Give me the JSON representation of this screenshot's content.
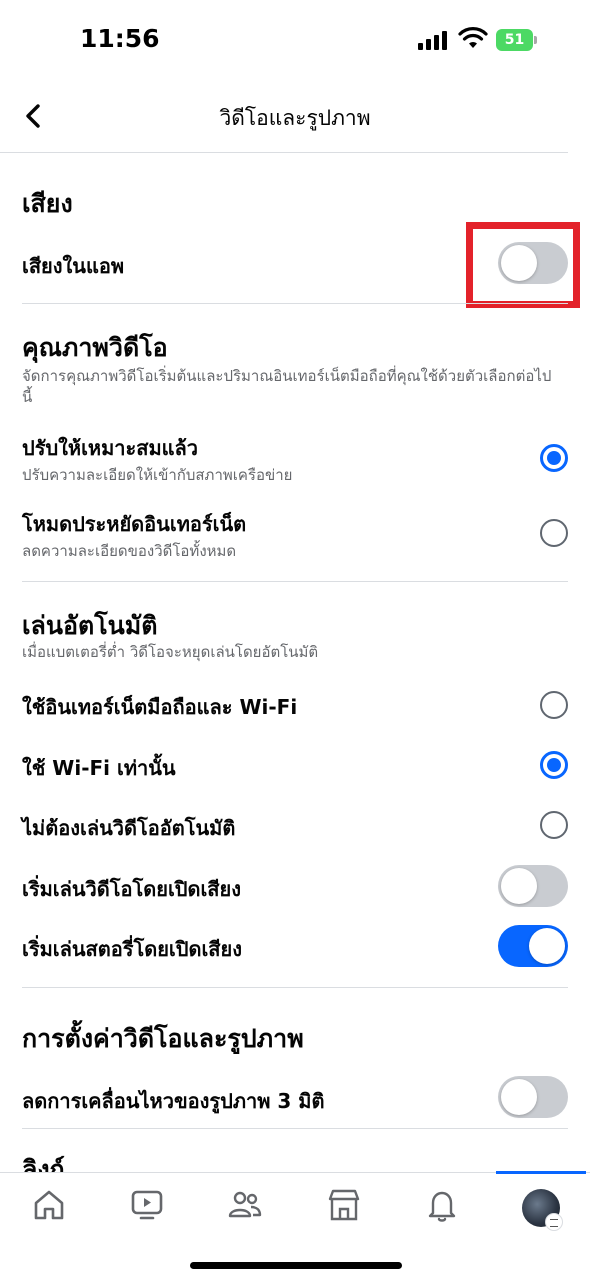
{
  "status_bar": {
    "time": "11:56",
    "battery": "51"
  },
  "header": {
    "title": "วิดีโอและรูปภาพ",
    "back_icon": "chevron-left-icon"
  },
  "sound": {
    "title": "เสียง",
    "in_app_sound": {
      "label": "เสียงในแอพ",
      "on": false
    }
  },
  "video_quality": {
    "title": "คุณภาพวิดีโอ",
    "description": "จัดการคุณภาพวิดีโอเริ่มต้นและปริมาณอินเทอร์เน็ตมือถือที่คุณใช้ด้วยตัวเลือกต่อไปนี้",
    "options": [
      {
        "label": "ปรับให้เหมาะสมแล้ว",
        "sub": "ปรับความละเอียดให้เข้ากับสภาพเครือข่าย",
        "selected": true
      },
      {
        "label": "โหมดประหยัดอินเทอร์เน็ต",
        "sub": "ลดความละเอียดของวิดีโอทั้งหมด",
        "selected": false
      }
    ]
  },
  "autoplay": {
    "title": "เล่นอัตโนมัติ",
    "description": "เมื่อแบตเตอรี่ต่ำ วิดีโอจะหยุดเล่นโดยอัตโนมัติ",
    "options": [
      {
        "label": "ใช้อินเทอร์เน็ตมือถือและ Wi-Fi",
        "selected": false
      },
      {
        "label": "ใช้ Wi-Fi เท่านั้น",
        "selected": true
      },
      {
        "label": "ไม่ต้องเล่นวิดีโออัตโนมัติ",
        "selected": false
      }
    ],
    "toggles": [
      {
        "label": "เริ่มเล่นวิดีโอโดยเปิดเสียง",
        "on": false
      },
      {
        "label": "เริ่มเล่นสตอรี่โดยเปิดเสียง",
        "on": true
      }
    ]
  },
  "video_photo_settings": {
    "title": "การตั้งค่าวิดีโอและรูปภาพ",
    "reduce_3d": {
      "label": "ลดการเคลื่อนไหวของรูปภาพ 3 มิติ",
      "on": false
    },
    "next_section_partial": "ลิงก์"
  },
  "colors": {
    "accent": "#0866ff",
    "highlight": "#e3222a",
    "toggle_off": "#c9ccd1"
  },
  "tab_bar": {
    "tabs": [
      {
        "icon": "home-icon"
      },
      {
        "icon": "video-icon"
      },
      {
        "icon": "friends-icon"
      },
      {
        "icon": "marketplace-icon"
      },
      {
        "icon": "bell-icon"
      },
      {
        "icon": "profile-avatar",
        "active": true
      }
    ]
  }
}
